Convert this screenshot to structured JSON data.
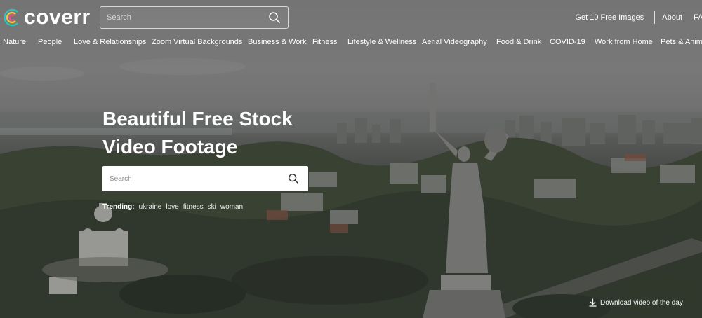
{
  "brand": {
    "logo_text": "coverr",
    "logo_colors": [
      "#2ec4b6",
      "#f6c343",
      "#e94f8a"
    ]
  },
  "header": {
    "search_placeholder": "Search",
    "links": {
      "free_images": "Get 10 Free Images",
      "about": "About",
      "faq": "FAQ"
    }
  },
  "categories": [
    "Nature",
    "People",
    "Love & Relationships",
    "Zoom Virtual Backgrounds",
    "Business & Work",
    "Fitness",
    "Lifestyle & Wellness",
    "Aerial Videography",
    "Food & Drink",
    "COVID-19",
    "Work from Home",
    "Pets & Animals"
  ],
  "hero": {
    "title_line1": "Beautiful Free Stock",
    "title_line2": "Video Footage",
    "search_placeholder": "Search",
    "trending_label": "Trending:",
    "trending_tags": [
      "ukraine",
      "love",
      "fitness",
      "ski",
      "woman"
    ]
  },
  "footer": {
    "download_label": "Download video of the day"
  },
  "icons": {
    "search": "search-icon",
    "download": "download-icon"
  }
}
